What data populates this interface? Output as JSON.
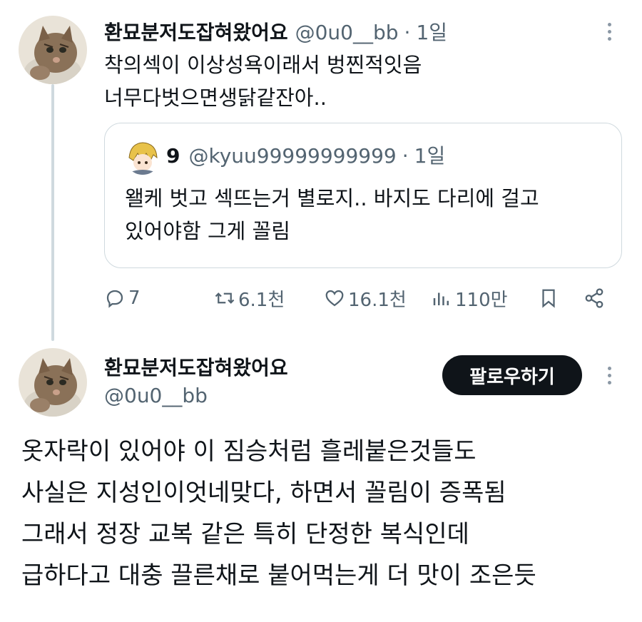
{
  "thread": {
    "parent_tweet": {
      "display_name": "환묘분저도잡혀왔어요",
      "handle": "@0u0__bb",
      "separator": "·",
      "time": "1일",
      "text_lines": [
        "착의섹이 이상성욕이래서 벙찐적잇음",
        "너무다벗으면생닭같잔아.."
      ],
      "quote": {
        "display_name": "9",
        "handle": "@kyuu99999999999",
        "separator": "·",
        "time": "1일",
        "text_lines": [
          "왤케 벗고 섹뜨는거 별로지.. 바지도 다리에 걸고",
          "있어야함 그게 꼴림"
        ]
      },
      "actions": {
        "replies": "7",
        "retweets": "6.1천",
        "likes": "16.1천",
        "views": "110만"
      }
    },
    "main_tweet": {
      "display_name": "환묘분저도잡혀왔어요",
      "handle": "@0u0__bb",
      "follow_label": "팔로우하기",
      "text_lines": [
        "옷자락이 있어야 이 짐승처럼 흘레붙은것들도",
        "사실은 지성인이엇네맞다, 하면서 꼴림이 증폭됨",
        "그래서 정장 교복 같은 특히 단정한 복식인데",
        "급하다고 대충 끌른채로 붙어먹는게 더 맛이 조은듯"
      ]
    }
  },
  "icons": {
    "reply": "reply-icon",
    "retweet": "retweet-icon",
    "like": "heart-icon",
    "views": "views-icon",
    "bookmark": "bookmark-icon",
    "share": "share-icon",
    "more": "more-icon"
  },
  "colors": {
    "text": "#0f1419",
    "secondary": "#536471",
    "border": "#cfd9de",
    "follow_bg": "#0f1419"
  }
}
